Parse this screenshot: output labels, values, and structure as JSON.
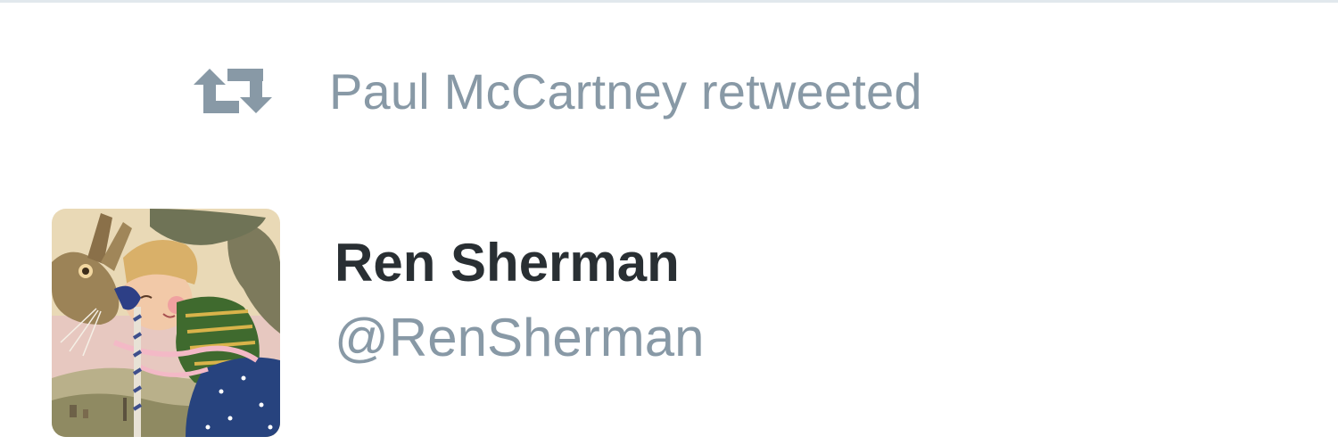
{
  "retweet_context": {
    "icon": "retweet-icon",
    "label": "Paul McCartney retweeted"
  },
  "tweet": {
    "author": {
      "avatar": "avatar-illustration",
      "display_name": "Ren Sherman",
      "username": "@RenSherman"
    }
  },
  "colors": {
    "muted_text": "#8899a6",
    "name_text": "#292f33",
    "divider": "#e1e8ed",
    "background": "#ffffff"
  }
}
